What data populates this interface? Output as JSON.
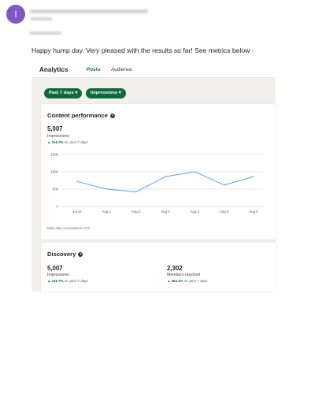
{
  "email": {
    "avatar_letter": "I",
    "message": "Happy hump day. Very pleased with the results so far! See metrics below -"
  },
  "analytics": {
    "title": "Analytics",
    "tabs": [
      {
        "label": "Posts",
        "active": true
      },
      {
        "label": "Audience",
        "active": false
      }
    ],
    "filters": [
      {
        "label": "Past 7 days ▾"
      },
      {
        "label": "Impressions ▾"
      }
    ]
  },
  "content_performance": {
    "title": "Content performance",
    "value": "5,007",
    "label": "Impressions",
    "change_value": "▲ 216.7%",
    "change_text": "vs. prior 7 days",
    "note": "Daily data is recorded in UTC"
  },
  "discovery": {
    "title": "Discovery",
    "metrics": [
      {
        "value": "5,007",
        "label": "Impressions",
        "change_value": "▲ 216.7%",
        "change_text": "vs. prior 7 days"
      },
      {
        "value": "2,302",
        "label": "Members reached",
        "change_value": "▲ 263.1%",
        "change_text": "vs. prior 7 days"
      }
    ]
  },
  "colors": {
    "accent_green": "#0f6b3c",
    "line_blue": "#5aa0e6",
    "avatar_purple": "#7b59c9"
  },
  "chart_data": {
    "type": "line",
    "categories": [
      "Jul 31",
      "Aug 1",
      "Aug 2",
      "Aug 3",
      "Aug 4",
      "Aug 5",
      "Aug 6"
    ],
    "series": [
      {
        "values": [
          720,
          500,
          420,
          860,
          1000,
          620,
          860
        ]
      }
    ],
    "yticks": [
      "0",
      "500",
      "1000",
      "1500"
    ],
    "ylim": [
      0,
      1500
    ],
    "grid": true
  }
}
